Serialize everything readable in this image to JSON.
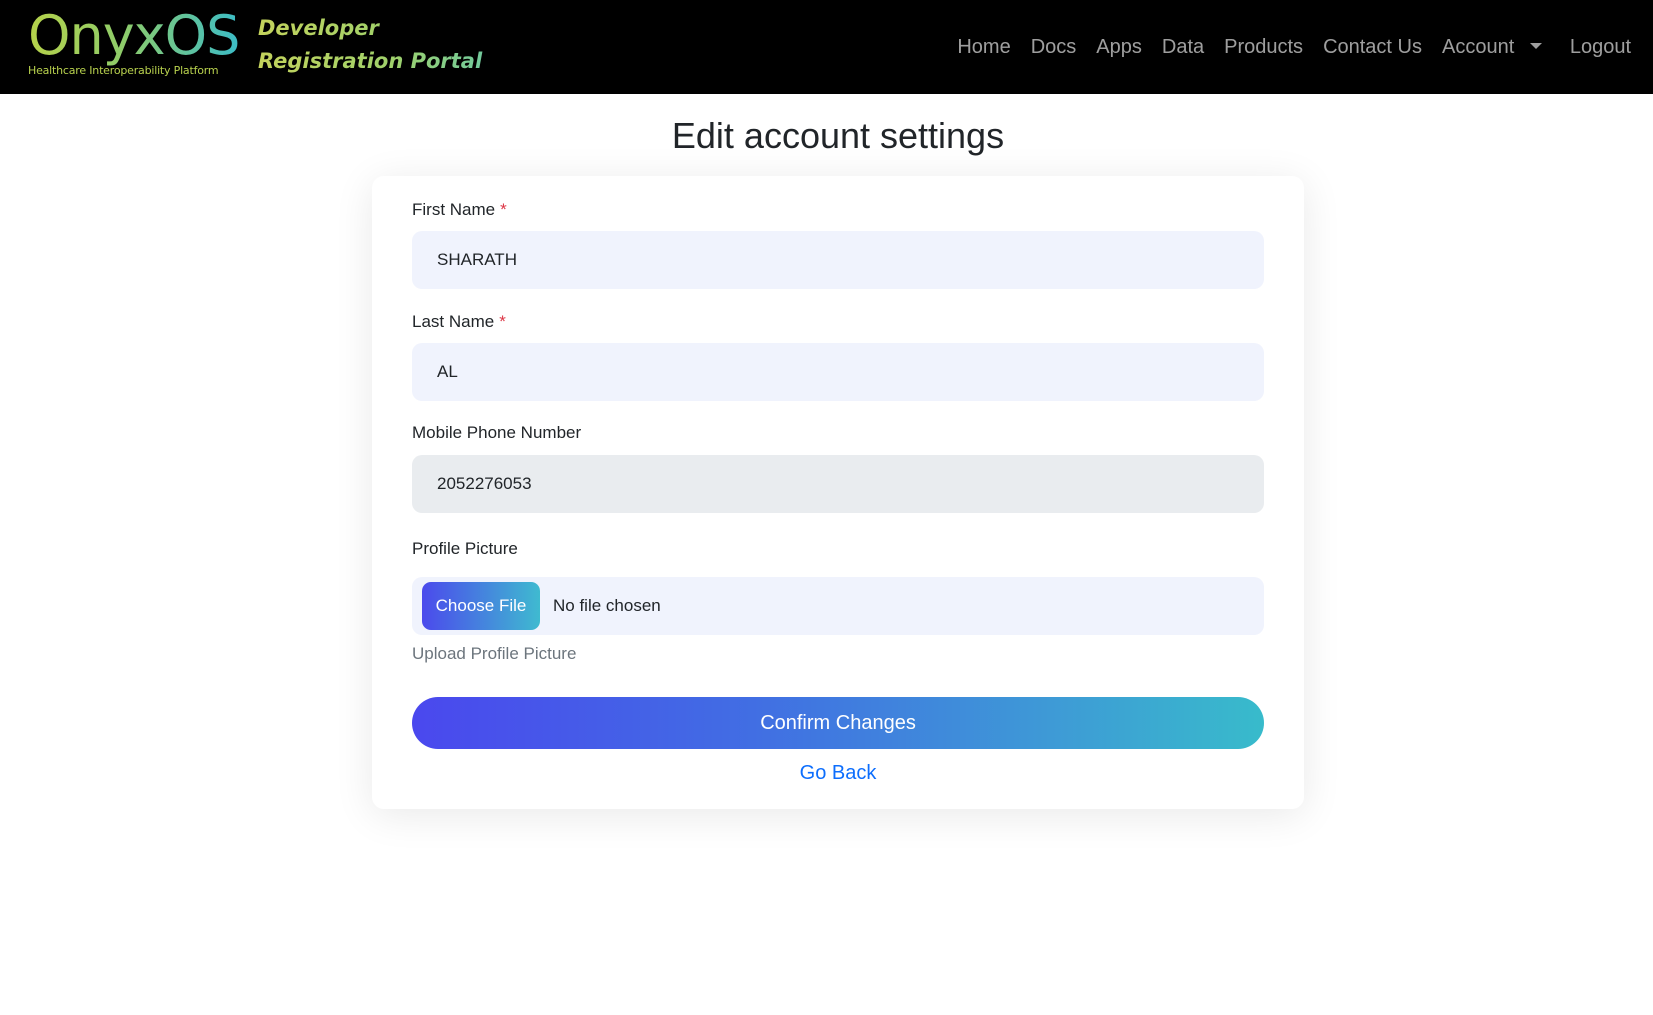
{
  "navbar": {
    "brand_name": "OnyxOS",
    "brand_tagline": "Healthcare Interoperability Platform",
    "portal_title": "Developer Registration Portal",
    "links": {
      "home": "Home",
      "docs": "Docs",
      "apps": "Apps",
      "data": "Data",
      "products": "Products",
      "contact": "Contact Us",
      "account": "Account",
      "logout": "Logout"
    }
  },
  "page": {
    "title": "Edit account settings"
  },
  "form": {
    "first_name": {
      "label": "First Name",
      "required_mark": "*",
      "value": "SHARATH"
    },
    "last_name": {
      "label": "Last Name",
      "required_mark": "*",
      "value": "AL"
    },
    "mobile": {
      "label": "Mobile Phone Number",
      "value": "2052276053"
    },
    "profile_picture": {
      "label": "Profile Picture",
      "button_label": "Choose File",
      "status": "No file chosen",
      "help_text": "Upload Profile Picture"
    },
    "confirm_label": "Confirm Changes",
    "go_back_label": "Go Back"
  },
  "colors": {
    "navbar_bg": "#000000",
    "input_bg": "#f0f3fd",
    "disabled_input_bg": "#e9ecef",
    "gradient_start": "#4a48ee",
    "gradient_end": "#38bbcb",
    "link": "#0d6efd",
    "required": "#dc3545"
  }
}
